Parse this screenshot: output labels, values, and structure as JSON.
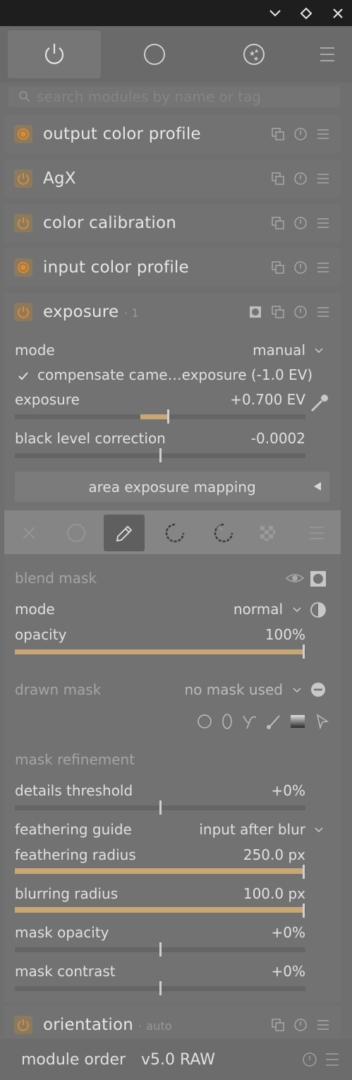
{
  "window": {
    "controls": [
      {
        "name": "minimize-button",
        "glyph": "chevron-down-icon"
      },
      {
        "name": "maximize-button",
        "glyph": "diamond-icon"
      },
      {
        "name": "close-button",
        "glyph": "close-icon"
      }
    ]
  },
  "tabs": [
    {
      "name": "active-modules",
      "icon": "power-icon",
      "active": true
    },
    {
      "name": "all-modules",
      "icon": "circle-icon",
      "active": false
    },
    {
      "name": "favourites",
      "icon": "stars-icon",
      "active": false
    }
  ],
  "search": {
    "placeholder": "search modules by name or tag"
  },
  "modules": {
    "output_color_profile": {
      "name": "output color profile"
    },
    "agx": {
      "name": "AgX"
    },
    "color_calibration": {
      "name": "color calibration"
    },
    "input_color_profile": {
      "name": "input color profile"
    },
    "exposure": {
      "name": "exposure",
      "instance": "· 1",
      "mode_label": "mode",
      "mode_value": "manual",
      "compensate_label": "compensate came…exposure (-1.0 EV)",
      "exposure_label": "exposure",
      "exposure_value": "+0.700 EV",
      "exposure_fraction": 0.54,
      "black_label": "black level correction",
      "black_value": "-0.0002",
      "area_button": "area exposure mapping"
    },
    "orientation": {
      "name": "orientation",
      "instance": "· auto"
    }
  },
  "blend": {
    "section_title": "blend mask",
    "mode_label": "mode",
    "mode_value": "normal",
    "opacity_label": "opacity",
    "opacity_value": "100%",
    "opacity_fraction": 1.0,
    "drawn_mask_label": "drawn mask",
    "drawn_mask_value": "no mask used",
    "refinement_title": "mask refinement",
    "details_label": "details threshold",
    "details_value": "+0%",
    "feather_guide_label": "feathering guide",
    "feather_guide_value": "input after blur",
    "feather_radius_label": "feathering radius",
    "feather_radius_value": "250.0 px",
    "blur_radius_label": "blurring radius",
    "blur_radius_value": "100.0 px",
    "mask_opacity_label": "mask opacity",
    "mask_opacity_value": "+0%",
    "mask_contrast_label": "mask contrast",
    "mask_contrast_value": "+0%"
  },
  "footer": {
    "label": "module order",
    "value": "v5.0 RAW"
  },
  "colors": {
    "accent": "#c9a774",
    "power_on": "#e08a2a",
    "background": "#6f6f6f"
  }
}
